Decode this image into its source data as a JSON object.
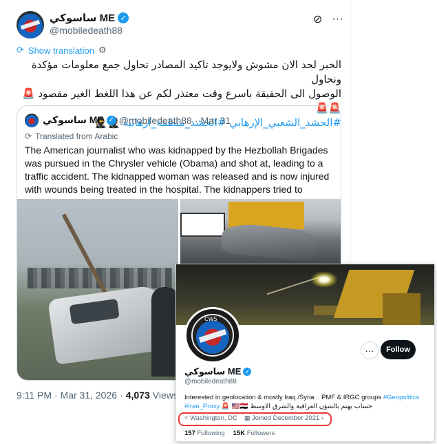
{
  "tweet": {
    "author_name": "ساسوكي ME",
    "author_handle": "@mobiledeath88",
    "show_translation": "Show translation",
    "text_line1": "الخبر لحد الان مشوش ولايوجد تاكيد المصادر تحاول جمع معلومات مؤكدة ونحاول",
    "text_line2": "الوصول الى الحقيقة باسرع وقت معتذر لكم عن هذا اللغط الغير مقصود 🚨🚨🚨",
    "text_line3_hashtags": "#الحشد_الشعبي_الإرهابي  #الحشد_منظمة_ارهابية",
    "text_line3_emoji": "🥷🥷",
    "timestamp": "9:11 PM · Mar 31, 2026",
    "views_count": "4,073",
    "views_label": "Views"
  },
  "quote": {
    "author_name": "ساسوكي ME",
    "author_handle": "@mobiledeath88",
    "date": "Mar 31",
    "translated_label": "Translated from Arabic",
    "text": "The American journalist who was kidnapped by the Hezbollah Brigades was pursued in the Chrysler vehicle (Obama) and shot at, leading to a traffic accident. The kidnapped woman was released and is now injured with wounds being treated in the hospital. The kidnappers tried to"
  },
  "profile_card": {
    "avatar_text": "CWS",
    "follow_label": "Follow",
    "name": "ساسوكي ME",
    "handle": "@mobiledeath88",
    "bio_line1": "Interested in geolocation & mostly  Iraq /Syria  .. PMF & IRGC groups",
    "bio_hashtag1": "#Geopolitics",
    "bio_hashtag2": "#Iran_Proxy",
    "bio_arabic": "🚨 🇺🇸🇮🇶 حساب يهتم بالشؤن العراقية والشرق الاوسط",
    "location": "Washington, DC",
    "joined": "Joined December 2021",
    "following_count": "157",
    "following_label": "Following",
    "followers_count": "15K",
    "followers_label": "Followers"
  },
  "colors": {
    "accent": "#1d9bf0",
    "highlight_box": "#e53935",
    "follow_button": "#0f1419"
  }
}
